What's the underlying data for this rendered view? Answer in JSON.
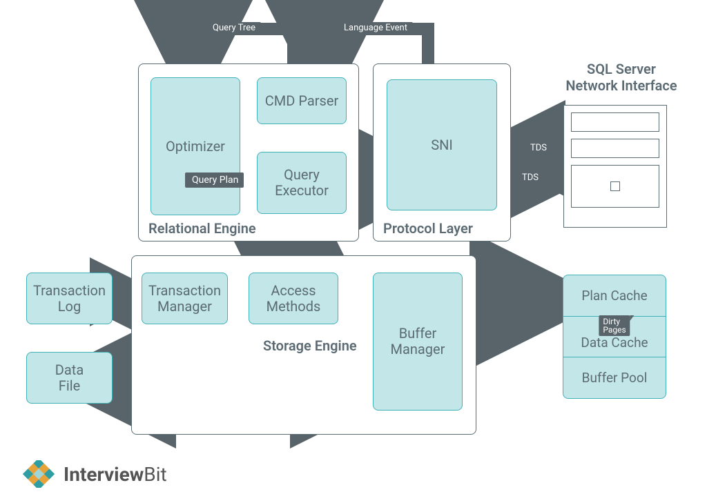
{
  "title_sql_network": "SQL Server\nNetwork Interface",
  "panels": {
    "relational": "Relational Engine",
    "protocol": "Protocol Layer",
    "storage": "Storage Engine"
  },
  "boxes": {
    "optimizer": "Optimizer",
    "cmd_parser": "CMD Parser",
    "query_executor": "Query\nExecutor",
    "sni": "SNI",
    "transaction_log": "Transaction\nLog",
    "transaction_manager": "Transaction\nManager",
    "access_methods": "Access\nMethods",
    "buffer_manager": "Buffer\nManager",
    "data_file": "Data\nFile",
    "plan_cache": "Plan Cache",
    "data_cache": "Data Cache",
    "buffer_pool": "Buffer Pool"
  },
  "labels": {
    "query_tree": "Query Tree",
    "language_event": "Language Event",
    "query_plan": "Query Plan",
    "tds1": "TDS",
    "tds2": "TDS",
    "dirty_pages": "Dirty\nPages"
  },
  "brand": {
    "name_a": "Interview",
    "name_b": "Bit"
  },
  "colors": {
    "panel_border": "#5b6b74",
    "box_fill": "#c3e6e8",
    "box_border": "#3fb1b7",
    "arrow": "#58646a"
  }
}
